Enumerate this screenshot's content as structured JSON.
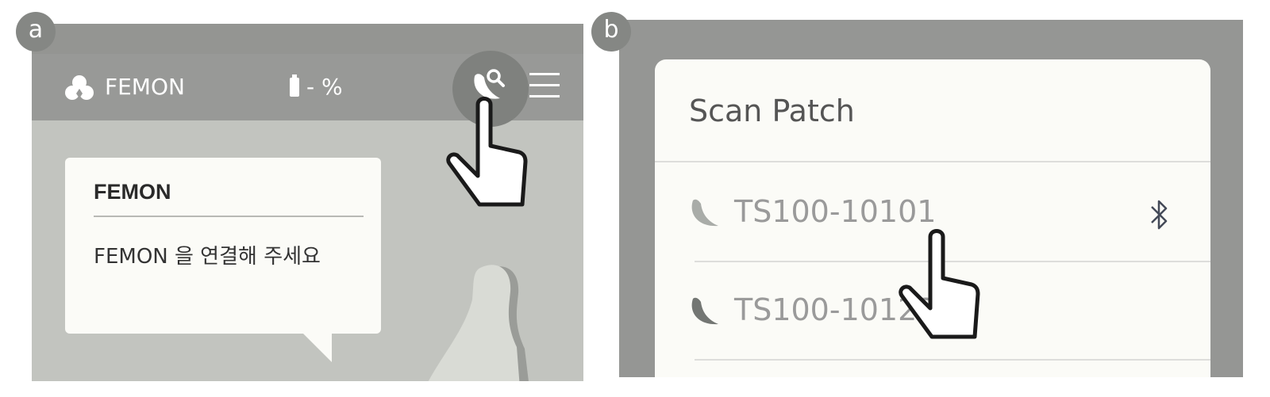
{
  "panel_a": {
    "label": "a",
    "app_title": "FEMON",
    "battery_text": "- %",
    "dialog": {
      "title": "FEMON",
      "message": "FEMON 을 연결해 주세요"
    }
  },
  "panel_b": {
    "label": "b",
    "title": "Scan Patch",
    "devices": [
      {
        "name": "TS100-10101",
        "bluetooth": true
      },
      {
        "name": "TS100-10123",
        "bluetooth": false
      }
    ]
  },
  "colors": {
    "app_bar": "#989997",
    "background": "#c2c4bf",
    "card": "#fbfbf7",
    "device_icon_first": "#a9aca8",
    "device_icon_second": "#737673"
  },
  "icons": [
    "app-logo-icon",
    "battery-icon",
    "scan-patch-icon",
    "menu-icon",
    "patch-icon",
    "bluetooth-icon",
    "pointing-hand-icon"
  ]
}
